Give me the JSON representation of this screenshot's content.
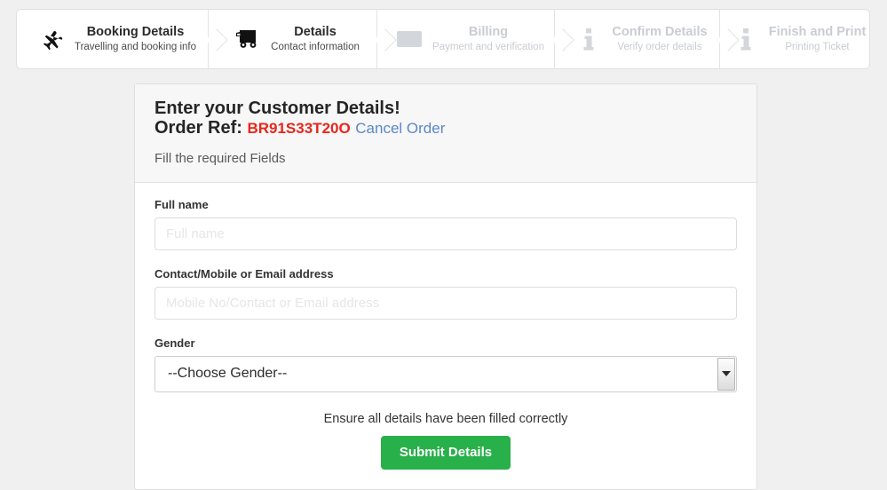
{
  "wizard": {
    "steps": [
      {
        "icon": "airplane-icon",
        "title": "Booking Details",
        "subtitle": "Travelling and booking info",
        "state": "active"
      },
      {
        "icon": "truck-icon",
        "title": "Details",
        "subtitle": "Contact information",
        "state": "active"
      },
      {
        "icon": "banknote-icon",
        "title": "Billing",
        "subtitle": "Payment and verification",
        "state": "inactive"
      },
      {
        "icon": "info-icon",
        "title": "Confirm Details",
        "subtitle": "Verify order details",
        "state": "inactive"
      },
      {
        "icon": "info-icon",
        "title": "Finish and Print",
        "subtitle": "Printing Ticket",
        "state": "inactive"
      }
    ]
  },
  "card": {
    "title": "Enter your Customer Details!",
    "order_ref_label": "Order Ref:",
    "order_ref_value": "BR91S33T20O",
    "cancel_order_label": "Cancel Order",
    "subtitle": "Fill the required Fields",
    "fields": {
      "fullname": {
        "label": "Full name",
        "value": "",
        "placeholder": "Full name"
      },
      "contact": {
        "label": "Contact/Mobile or Email address",
        "value": "",
        "placeholder": "Mobile No/Contact or Email address"
      },
      "gender": {
        "label": "Gender",
        "selected": "--Choose Gender--"
      }
    },
    "ensure_text": "Ensure all details have been filled correctly",
    "submit_label": "Submit Details"
  },
  "colors": {
    "page_background": "#f0f0f0",
    "order_ref": "#e8261c",
    "cancel_link": "#5b87c7",
    "submit_green": "#28b04a",
    "inactive_step": "#c9ccd1"
  }
}
